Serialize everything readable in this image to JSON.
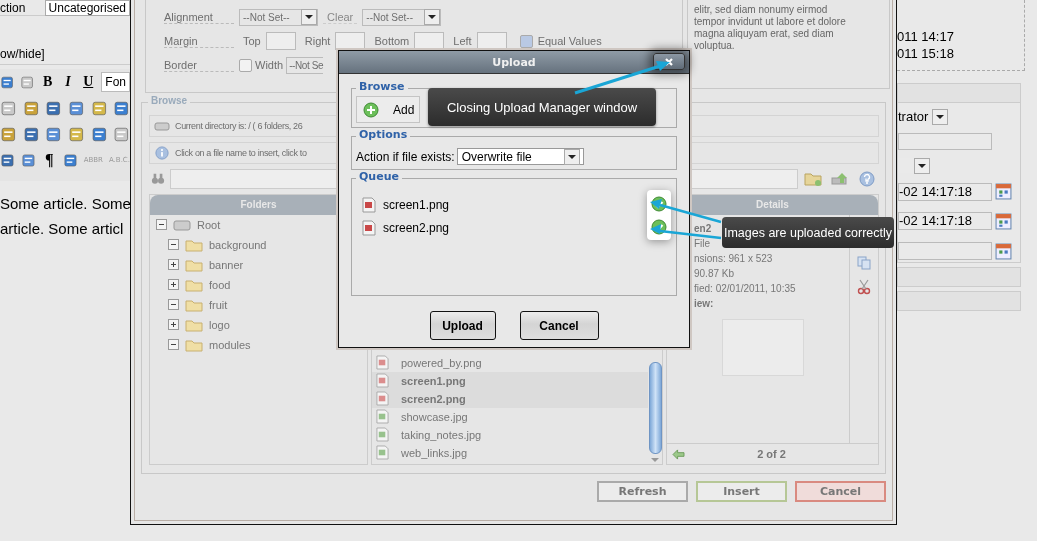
{
  "editor": {
    "section_label": "ction",
    "category_field": "Uncategorised",
    "toggle_link": "ow/hide]",
    "toolbar": [
      [
        {
          "kind": "icon"
        },
        {
          "kind": "icon"
        },
        {
          "kind": "bold",
          "label": "B"
        },
        {
          "kind": "italic",
          "label": "I"
        },
        {
          "kind": "underline",
          "label": "U"
        },
        {
          "kind": "select",
          "label": "Fon"
        }
      ],
      [
        {
          "kind": "icon"
        },
        {
          "kind": "icon"
        },
        {
          "kind": "icon"
        },
        {
          "kind": "icon"
        },
        {
          "kind": "icon"
        },
        {
          "kind": "icon"
        }
      ],
      [
        {
          "kind": "icon"
        },
        {
          "kind": "icon"
        },
        {
          "kind": "icon"
        },
        {
          "kind": "icon"
        },
        {
          "kind": "icon"
        },
        {
          "kind": "icon"
        }
      ],
      [
        {
          "kind": "icon"
        },
        {
          "kind": "icon"
        },
        {
          "kind": "glyph",
          "label": "¶"
        },
        {
          "kind": "icon"
        },
        {
          "kind": "small",
          "label": "ABBR"
        },
        {
          "kind": "small",
          "label": "A.B.C."
        }
      ]
    ],
    "article_lines": [
      "Some article. Some",
      "article. Some articl"
    ]
  },
  "side_panel": {
    "dates": [
      "011 14:17",
      "011 15:18"
    ],
    "author_select": "trator",
    "date_fields": [
      "-02 14:17:18",
      "-02 14:17:18"
    ]
  },
  "image_dialog": {
    "alignment": {
      "label": "Alignment",
      "select": "--Not Set--",
      "clear": "Clear",
      "select_2": "--Not Set--"
    },
    "margin": {
      "label": "Margin",
      "sides": [
        "Top",
        "Right",
        "Bottom",
        "Left"
      ],
      "equal_values": {
        "label": "Equal Values",
        "checked": true
      }
    },
    "border": {
      "label": "Border",
      "width": {
        "label": "Width",
        "checked": false
      },
      "select": "--Not Se"
    },
    "description_lines": [
      "elitr, sed diam nonumy eirmod",
      "tempor invidunt ut labore et dolore",
      "magna aliquyam erat, sed diam",
      "voluptua."
    ],
    "browse": {
      "legend": "Browse",
      "current_directory": "Current directory is: / ( 6 folders, 26",
      "hint": "Click on a file name to insert, click to",
      "folders_header": "Folders",
      "tree": {
        "label": "Root",
        "expanded": true,
        "children": [
          {
            "label": "background",
            "expanded": true
          },
          {
            "label": "banner",
            "expanded": false
          },
          {
            "label": "food",
            "expanded": false
          },
          {
            "label": "fruit",
            "expanded": true
          },
          {
            "label": "logo",
            "expanded": false
          },
          {
            "label": "modules",
            "expanded": true
          }
        ]
      },
      "files": [
        {
          "name": "powered_by.png",
          "kind": "png",
          "selected": false
        },
        {
          "name": "screen1.png",
          "kind": "png",
          "selected": true
        },
        {
          "name": "screen2.png",
          "kind": "png",
          "selected": true
        },
        {
          "name": "showcase.jpg",
          "kind": "jpg",
          "selected": false
        },
        {
          "name": "taking_notes.jpg",
          "kind": "jpg",
          "selected": false
        },
        {
          "name": "web_links.jpg",
          "kind": "jpg",
          "selected": false
        }
      ],
      "details_header": "Details",
      "details_lines": [
        "en2",
        "File",
        "nsions: 961 x 523",
        "90.87 Kb",
        "fied: 02/01/2011, 10:35"
      ],
      "preview_label": "iew:",
      "pager": "2 of 2"
    },
    "buttons": [
      {
        "label": "Refresh",
        "kind": "neutral"
      },
      {
        "label": "Insert",
        "kind": "confirm"
      },
      {
        "label": "Cancel",
        "kind": "danger"
      }
    ]
  },
  "upload_dialog": {
    "title": "Upload",
    "browse_legend": "Browse",
    "add_button": "Add",
    "options_legend": "Options",
    "action_label": "Action if file exists:",
    "action_select": "Overwrite file",
    "queue_legend": "Queue",
    "queue": [
      {
        "name": "screen1.png",
        "uploaded": true
      },
      {
        "name": "screen2.png",
        "uploaded": true
      }
    ],
    "buttons": [
      "Upload",
      "Cancel"
    ]
  },
  "callouts": [
    "Closing Upload Manager window",
    "Images are uploaded correctly"
  ]
}
